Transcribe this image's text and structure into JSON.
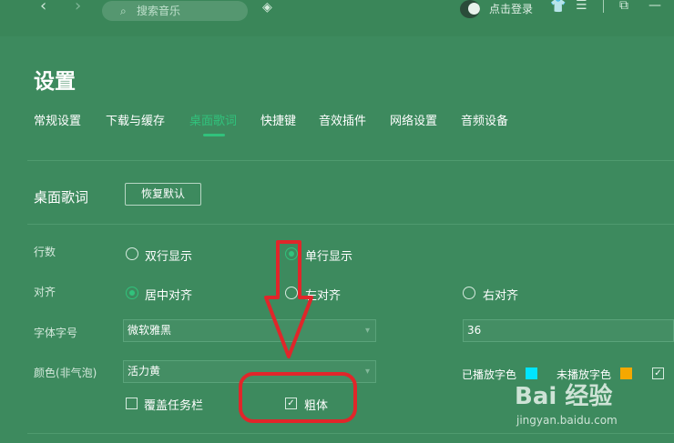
{
  "topbar": {
    "back_icon": "chevron-left-icon",
    "forward_icon": "chevron-right-icon",
    "search_placeholder": "搜索音乐",
    "login_label": "点击登录"
  },
  "settings": {
    "title": "设置",
    "tabs": [
      {
        "label": "常规设置",
        "active": false
      },
      {
        "label": "下载与缓存",
        "active": false
      },
      {
        "label": "桌面歌词",
        "active": true
      },
      {
        "label": "快捷键",
        "active": false
      },
      {
        "label": "音效插件",
        "active": false
      },
      {
        "label": "网络设置",
        "active": false
      },
      {
        "label": "音频设备",
        "active": false
      }
    ],
    "section": {
      "title": "桌面歌词",
      "reset_button": "恢复默认"
    },
    "rows": {
      "lines": {
        "label": "行数",
        "options": [
          "双行显示",
          "单行显示"
        ],
        "selected": "单行显示"
      },
      "align": {
        "label": "对齐",
        "options": [
          "居中对齐",
          "左对齐",
          "右对齐"
        ],
        "selected": "居中对齐"
      },
      "font": {
        "label": "字体字号",
        "family": "微软雅黑",
        "size": "36"
      },
      "color": {
        "label": "颜色(非气泡)",
        "theme": "活力黄",
        "played_label": "已播放字色",
        "unplayed_label": "未播放字色",
        "played_color": "#00e5ff",
        "unplayed_color": "#f5a800"
      },
      "options": {
        "cover_taskbar": "覆盖任务栏",
        "cover_taskbar_checked": false,
        "bold": "粗体",
        "bold_checked": true
      }
    }
  },
  "colors": {
    "background": "#3d8a5e",
    "accent": "#31c27c",
    "annotation": "#e0262a"
  },
  "watermark": {
    "brand": "Bai 经验",
    "url": "jingyan.baidu.com"
  }
}
